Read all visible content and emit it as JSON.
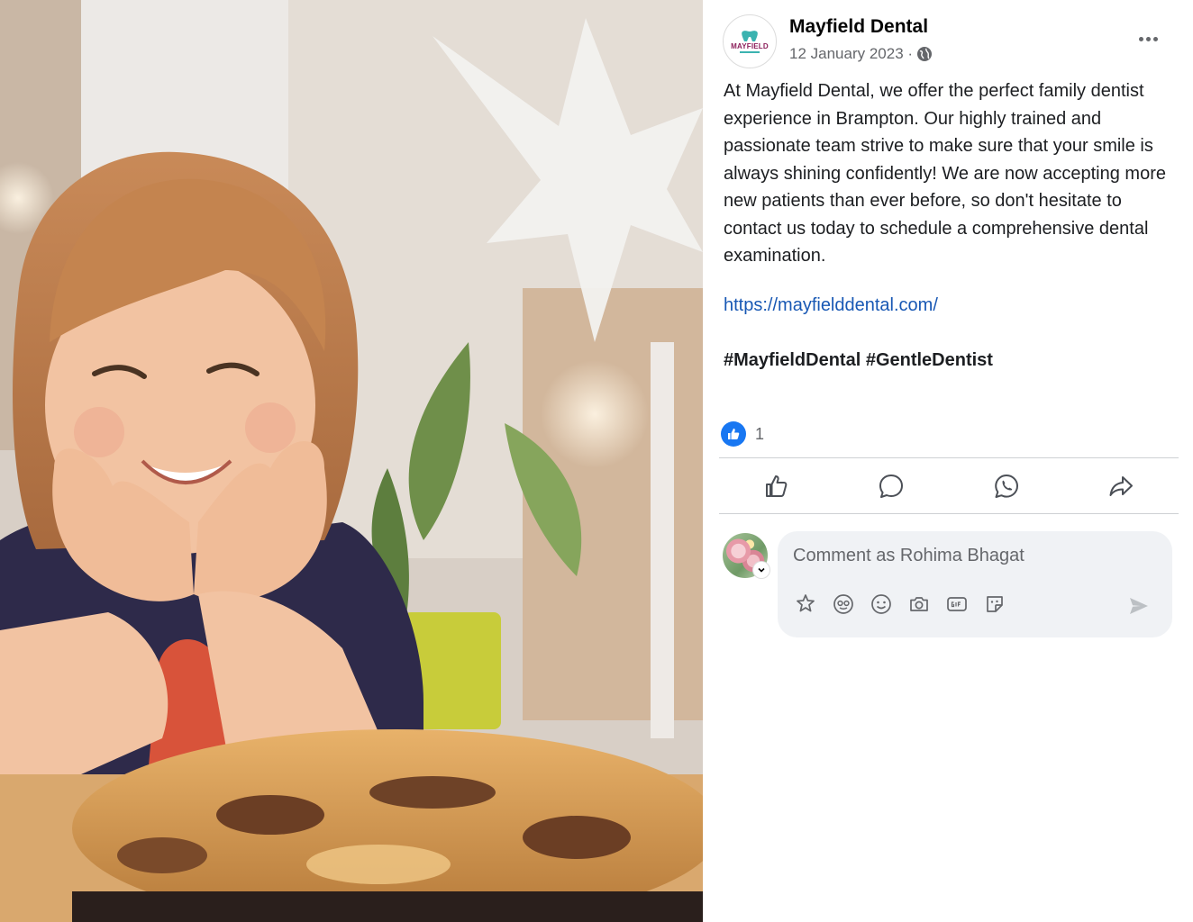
{
  "post": {
    "page_name": "Mayfield Dental",
    "logo_text": "MAYFIELD",
    "date": "12 January 2023 ·",
    "body": "At Mayfield Dental, we offer the perfect family dentist experience in Brampton. Our highly trained and passionate team strive to make sure that your smile is always shining confidently! We are now accepting more new patients than ever before, so don't hesitate to contact us today to schedule a comprehensive dental examination.",
    "link": "https://mayfielddental.com/",
    "hashtags": "#MayfieldDental #GentleDentist",
    "reaction_count": "1"
  },
  "comment": {
    "placeholder": "Comment as Rohima Bhagat"
  },
  "icons": {
    "privacy": "globe-icon",
    "options": "more-horizontal-icon",
    "reaction": "like-badge-icon",
    "actions": [
      "like-icon",
      "comment-icon",
      "whatsapp-icon",
      "share-icon"
    ],
    "tools": [
      "avatar-sticker-icon",
      "emoji-face-icon",
      "smiley-icon",
      "camera-icon",
      "gif-icon",
      "sticker-icon"
    ],
    "send": "send-icon"
  },
  "colors": {
    "accent": "#1877f2",
    "link": "#1858b4",
    "muted": "#65676b",
    "comment_bg": "#f0f2f5"
  }
}
